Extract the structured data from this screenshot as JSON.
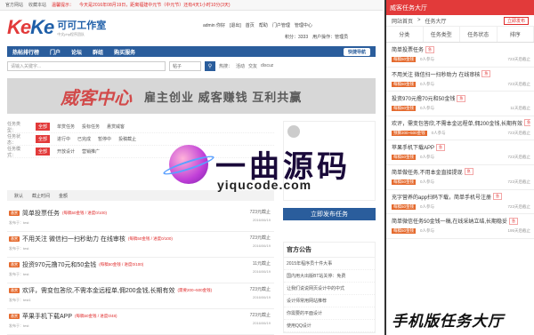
{
  "topbar": {
    "items": [
      "官方网站",
      "收藏本站",
      "温馨提示：",
      "今天是2016年08月19日，距离福建中元节（中元节）还有4天1小时10分(3天)"
    ]
  },
  "logo": {
    "brand_ke1": "Ke",
    "brand_ke2": "Ke",
    "name": "可可工作室",
    "tagline": "中文php程序团队"
  },
  "user": {
    "links": [
      "admin 你好",
      "[退出]",
      "首页",
      "帮助",
      "门户管理",
      "管理中心"
    ],
    "stats": [
      "积分：3333",
      "用户操作：管理员"
    ]
  },
  "nav": {
    "items": [
      "热帖排行榜",
      "门户",
      "论坛",
      "群组",
      "购买服务"
    ],
    "right_button": "快捷导航"
  },
  "search": {
    "placeholder": "请输入关键字...",
    "select": "帖子",
    "hot_label": "热搜：",
    "hot": [
      "活动",
      "交友",
      "discuz"
    ]
  },
  "banner": {
    "title": "威客中心",
    "slogan": "雇主创业 威客赚钱 互利共赢"
  },
  "filters": [
    {
      "label": "任务类型：",
      "options": [
        "全部",
        "单赏任务",
        "投标任务",
        "悬赏威客"
      ]
    },
    {
      "label": "任务状态：",
      "options": [
        "全部",
        "进行中",
        "已完成",
        "暂停中",
        "投稿截止"
      ]
    },
    {
      "label": "任务模式：",
      "options": [
        "全部",
        "开放设计",
        "营销推广"
      ]
    }
  ],
  "sortbar": {
    "items": [
      "默认",
      "截止时间",
      "金额"
    ]
  },
  "list": [
    {
      "tag": "悬赏",
      "title": "简单投票任务",
      "badge": "急",
      "meta": "发布于：test",
      "reward": "(每稿50金钱 / 进度0/100)",
      "views": "723元截止",
      "date": "2016/06/19"
    },
    {
      "tag": "悬赏",
      "title": "不用关注 微信扫一扫秒助力 在线审核",
      "badge": "急",
      "meta": "发布于：test",
      "reward": "(每稿50金钱 / 进度0/100)",
      "views": "723元截止",
      "date": "2016/06/19"
    },
    {
      "tag": "悬赏",
      "title": "投资970元撸70元和50金钱",
      "badge": "急",
      "meta": "发布于：test",
      "reward": "(每稿50金钱 / 进度0/100)",
      "views": "11元截止",
      "date": "2016/06/19"
    },
    {
      "tag": "悬赏",
      "title": "欢评，需变包答欣,不需本金远程单,佣200金钱,长期有效",
      "badge": "急",
      "meta": "发布于：test1",
      "reward": "(需要200~500金钱)",
      "views": "723元截止",
      "date": "2016/06/19"
    },
    {
      "tag": "悬赏",
      "title": "苹果手机下载APP",
      "badge": "急",
      "meta": "发布于：test",
      "reward": "(每稿50金钱 / 进度0/48)",
      "views": "723元截止",
      "date": "2016/06/19"
    }
  ],
  "sidebar": {
    "publish": "立即发布任务",
    "notice_title": "官方公告",
    "notices": [
      "2015年程序员十件大事",
      "国内用大出版BT站关停：免费",
      "让我们说说网页设计中的中式",
      "设计师常用网站推荐",
      "你需要的平面设计",
      "使用QQ设计"
    ]
  },
  "phone": {
    "header": "威客任务大厅",
    "bread": [
      "网站首页",
      ">",
      "任务大厅"
    ],
    "publish": "立即发布",
    "tabs": [
      "分类",
      "任务类型",
      "任务状态",
      "排序"
    ],
    "items": [
      {
        "title": "简单投票任务",
        "badge": "急",
        "price": "每稿50金钱",
        "count": "0人参与",
        "views": "723天后截止"
      },
      {
        "title": "不用关注 微信扫一扫秒助力 在线审核",
        "badge": "急",
        "price": "每稿50金钱",
        "count": "0人参与",
        "views": "723天后截止"
      },
      {
        "title": "投资970元撸70元和50金钱",
        "badge": "急",
        "price": "每稿50金钱",
        "count": "0人参与",
        "views": "11天后截止"
      },
      {
        "title": "欢评，需变包答欣,不需本金远程单,佣200金钱,长期有效",
        "badge": "急",
        "price": "预算200~500金钱",
        "count": "0人参与",
        "views": "723天后截止"
      },
      {
        "title": "苹果手机下载APP",
        "badge": "急",
        "price": "每稿50金钱",
        "count": "0人参与",
        "views": "723天后截止"
      },
      {
        "title": "简单做任务,不用本金直接提现",
        "badge": "急",
        "price": "每稿50金钱",
        "count": "0人参与",
        "views": "723天后截止"
      },
      {
        "title": "充字营养的app扫码下载，简单手机号注册",
        "badge": "急",
        "price": "每稿50金钱",
        "count": "0人参与",
        "views": "723天后截止"
      },
      {
        "title": "简单微信任务50金钱一稿,在线采纳立结,长期稳妥",
        "badge": "急",
        "price": "每稿50金钱",
        "count": "0人参与",
        "views": "195天后截止"
      }
    ],
    "caption": "手机版任务大厅"
  },
  "watermark": {
    "text": "一曲源码",
    "url": "yiqucode.com"
  }
}
